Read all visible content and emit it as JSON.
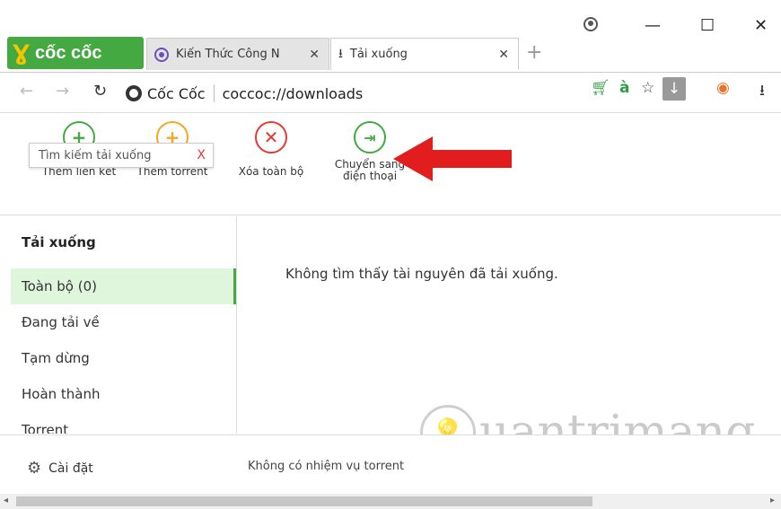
{
  "browser": {
    "logo_text": "cốc cốc",
    "tabs": [
      {
        "label": "Kiến Thức Công N"
      },
      {
        "label": "Tải xuống"
      }
    ],
    "new_tab": "+",
    "window_controls": {
      "minimize": "—",
      "maximize": "☐",
      "close": "✕"
    },
    "address": {
      "site_name": "Cốc Cốc",
      "url": "coccoc://downloads"
    },
    "icons": [
      "back-icon",
      "forward-icon",
      "reload-icon",
      "cart-icon",
      "translate-icon",
      "star-icon",
      "download-ext-icon",
      "coccoc-ext-icon",
      "download-icon"
    ]
  },
  "toolbar": {
    "search_placeholder": "Tìm kiếm tải xuống",
    "search_clear": "X",
    "add_link": "Thêm liên kết",
    "add_torrent": "Thêm torrent",
    "delete_all": "Xóa toàn bộ",
    "send_to_phone": "Chuyển sang điện thoại"
  },
  "sidebar": {
    "title": "Tải xuống",
    "items": [
      {
        "label": "Toàn bộ (0)",
        "active": true
      },
      {
        "label": "Đang tải về"
      },
      {
        "label": "Tạm dừng"
      },
      {
        "label": "Hoàn thành"
      },
      {
        "label": "Torrent"
      }
    ]
  },
  "main": {
    "empty_message": "Không tìm thấy tài nguyên đã tải xuống."
  },
  "footer": {
    "settings_label": "Cài đặt",
    "torrent_status": "Không có nhiệm vụ torrent"
  },
  "watermark": {
    "text": "uantrimang",
    "bulb_glyph": "💡"
  },
  "colors": {
    "brand_green": "#43a940",
    "logo_yellow": "#f6c300",
    "active_bg": "#dff6dc",
    "delete_red": "#e53935",
    "add_torrent_orange": "#f5a623",
    "arrow_red": "#e11d1d"
  }
}
